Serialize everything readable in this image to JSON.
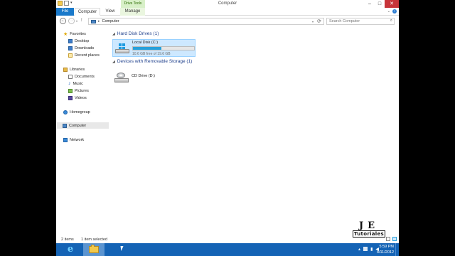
{
  "window": {
    "title": "Computer",
    "context_tab": "Drive Tools",
    "controls": {
      "minimize": "–",
      "maximize": "□",
      "close": "✕"
    }
  },
  "ribbon": {
    "tabs": [
      {
        "label": "File"
      },
      {
        "label": "Computer"
      },
      {
        "label": "View"
      },
      {
        "label": "Manage"
      }
    ],
    "expand_icon": "chevron-down-icon",
    "help_icon": "?"
  },
  "navbar": {
    "back": "←",
    "forward": "→",
    "up": "↑",
    "address": "Computer",
    "address_sep": "▸",
    "search_placeholder": "Search Computer",
    "search_glyph": "⌕"
  },
  "nav_pane": {
    "favorites": {
      "label": "Favorites",
      "items": [
        "Desktop",
        "Downloads",
        "Recent places"
      ]
    },
    "libraries": {
      "label": "Libraries",
      "items": [
        "Documents",
        "Music",
        "Pictures",
        "Videos"
      ]
    },
    "homegroup": "Homegroup",
    "computer": "Computer",
    "network": "Network"
  },
  "content": {
    "groups": [
      {
        "label": "Hard Disk Drives (1)"
      },
      {
        "label": "Devices with Removable Storage (1)"
      }
    ],
    "local_disk": {
      "name": "Local Disk (C:)",
      "free_text": "10.6 GB free of 19.6 GB",
      "used_fraction": 0.46
    },
    "cd_drive": {
      "name": "CD Drive (D:)"
    }
  },
  "status_bar": {
    "items": "2 items",
    "selected": "1 item selected"
  },
  "watermark": {
    "big": "JE",
    "small": "Tutoriales"
  },
  "taskbar": {
    "ie_glyph": "e",
    "clock_time": "5:59 PM",
    "clock_date": "8/11/2012"
  },
  "colors": {
    "accent": "#1979ca",
    "taskbar": "#1463b5",
    "selection": "#cde8ff",
    "usage_bar": "#26a0da",
    "group_header": "#1e3f8c"
  }
}
